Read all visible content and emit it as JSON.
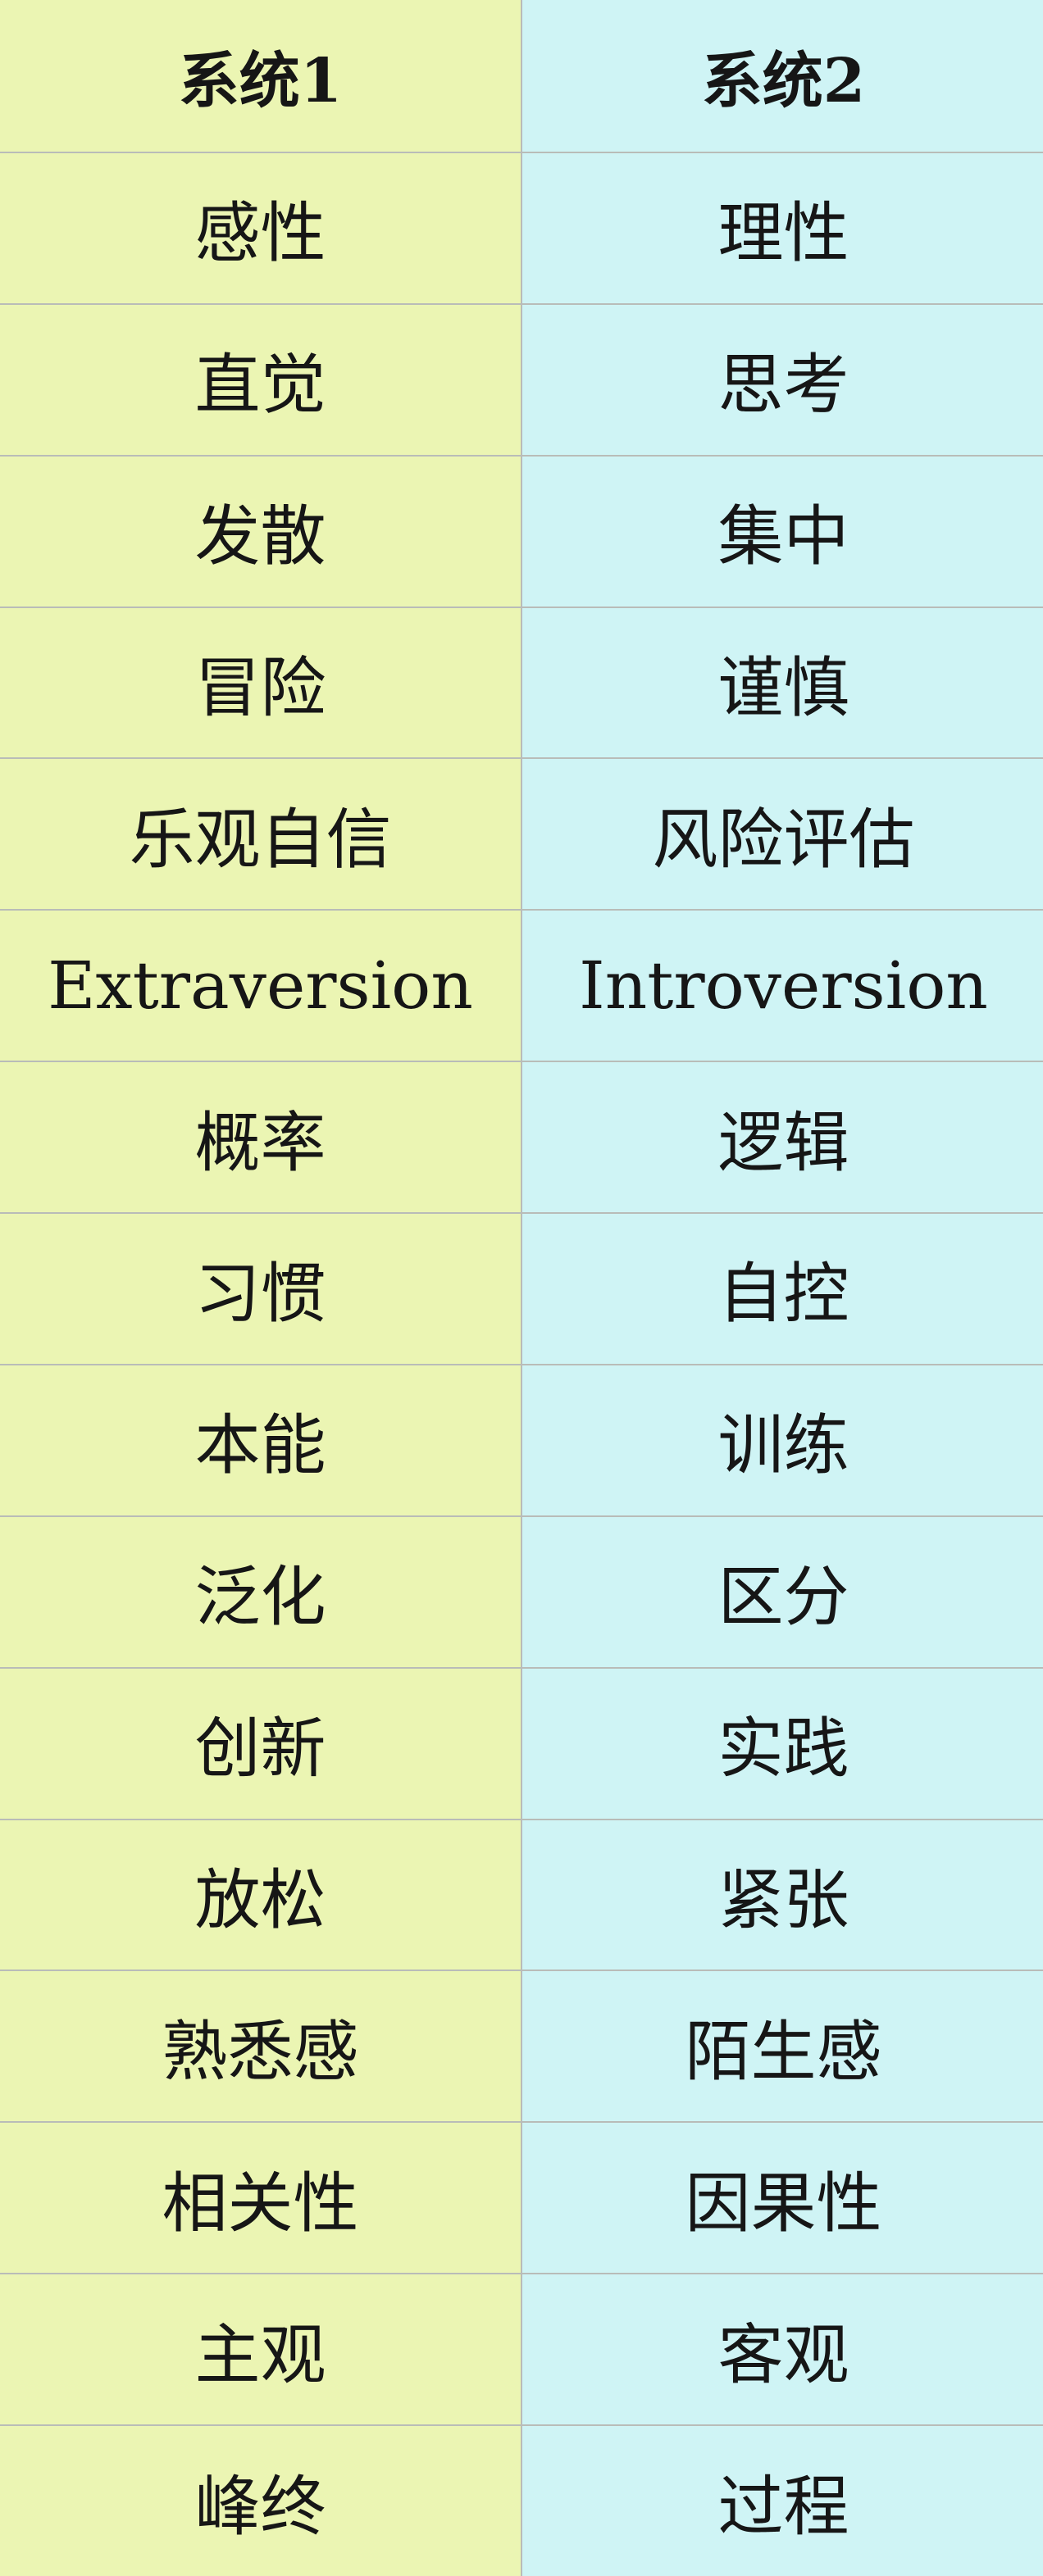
{
  "colors": {
    "system1_bg": "#ebf5b3",
    "system2_bg": "#cff4f5",
    "grid_line": "#b9bcb8",
    "text": "#161616"
  },
  "header": {
    "system1": "系统1",
    "system2": "系统2"
  },
  "rows": [
    {
      "system1": "感性",
      "system2": "理性"
    },
    {
      "system1": "直觉",
      "system2": "思考"
    },
    {
      "system1": "发散",
      "system2": "集中"
    },
    {
      "system1": "冒险",
      "system2": "谨慎"
    },
    {
      "system1": "乐观自信",
      "system2": "风险评估"
    },
    {
      "system1": "Extraversion",
      "system2": "Introversion"
    },
    {
      "system1": "概率",
      "system2": "逻辑"
    },
    {
      "system1": "习惯",
      "system2": "自控"
    },
    {
      "system1": "本能",
      "system2": "训练"
    },
    {
      "system1": "泛化",
      "system2": "区分"
    },
    {
      "system1": "创新",
      "system2": "实践"
    },
    {
      "system1": "放松",
      "system2": "紧张"
    },
    {
      "system1": "熟悉感",
      "system2": "陌生感"
    },
    {
      "system1": "相关性",
      "system2": "因果性"
    },
    {
      "system1": "主观",
      "system2": "客观"
    },
    {
      "system1": "峰终",
      "system2": "过程"
    }
  ]
}
